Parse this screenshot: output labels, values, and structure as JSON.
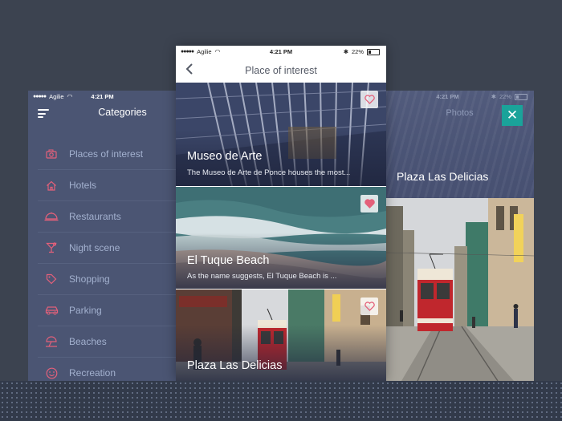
{
  "colors": {
    "background": "#3c4350",
    "accent_pink": "#e4607a",
    "close_teal": "#1aa39a",
    "panel_blue": "#4b5573"
  },
  "left_screen": {
    "status_bar": {
      "carrier": "Agilie",
      "time": "4:21 PM"
    },
    "title": "Categories",
    "menu_icon": "hamburger-menu-icon",
    "categories": [
      {
        "label": "Places of interest",
        "icon": "camera-icon"
      },
      {
        "label": "Hotels",
        "icon": "house-icon"
      },
      {
        "label": "Restaurants",
        "icon": "cloche-icon"
      },
      {
        "label": "Night scene",
        "icon": "cocktail-icon"
      },
      {
        "label": "Shopping",
        "icon": "tag-icon"
      },
      {
        "label": "Parking",
        "icon": "car-icon"
      },
      {
        "label": "Beaches",
        "icon": "umbrella-icon"
      },
      {
        "label": "Recreation",
        "icon": "smile-icon"
      }
    ]
  },
  "center_screen": {
    "status_bar": {
      "carrier": "Agilie",
      "time": "4:21 PM",
      "battery": "22%"
    },
    "title": "Place of interest",
    "places": [
      {
        "name": "Museo de Arte",
        "description": "The Museo de Arte de Ponce houses the most...",
        "favorite": false
      },
      {
        "name": "El Tuque Beach",
        "description": "As the name suggests, El Tuque Beach is ...",
        "favorite": true
      },
      {
        "name": "Plaza Las Delicias",
        "description": "",
        "favorite": false
      }
    ]
  },
  "right_screen": {
    "status_bar": {
      "time": "4:21 PM",
      "battery": "22%"
    },
    "title": "Photos",
    "place_name": "Plaza Las Delicias",
    "close_icon": "close-icon"
  }
}
